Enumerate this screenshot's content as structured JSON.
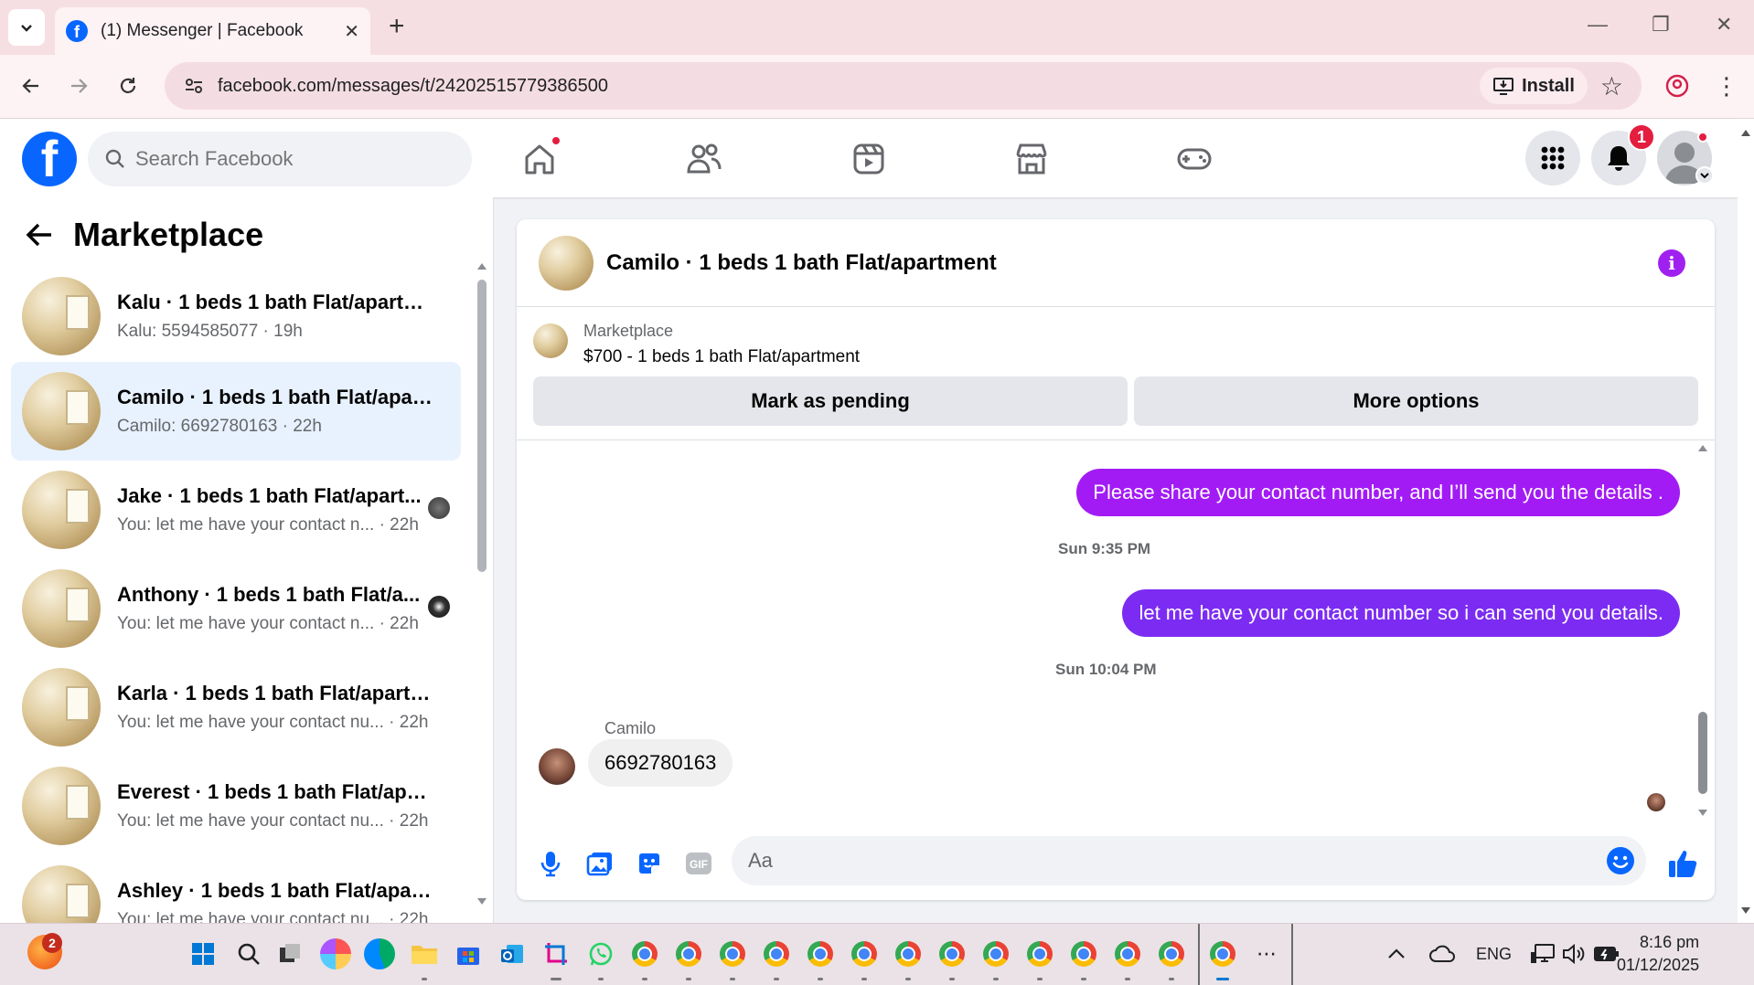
{
  "browser": {
    "tab_title": "(1) Messenger | Facebook",
    "url": "facebook.com/messages/t/24202515779386500",
    "install_label": "Install"
  },
  "fb": {
    "search_placeholder": "Search Facebook",
    "notification_count": "1"
  },
  "sidebar": {
    "title": "Marketplace",
    "conversations": [
      {
        "name": "Kalu · 1 beds 1 bath Flat/apartm...",
        "preview": "Kalu: 5594585077 · 19h"
      },
      {
        "name": "Camilo · 1 beds 1 bath Flat/apart...",
        "preview": "Camilo: 6692780163 · 22h"
      },
      {
        "name": "Jake · 1 beds 1 bath Flat/apart...",
        "preview": "You: let me have your contact n... · 22h"
      },
      {
        "name": "Anthony · 1 beds 1 bath Flat/a...",
        "preview": "You: let me have your contact n... · 22h"
      },
      {
        "name": "Karla · 1 beds 1 bath Flat/apartm...",
        "preview": "You: let me have your contact nu...  · 22h"
      },
      {
        "name": "Everest · 1 beds 1 bath Flat/apart...",
        "preview": "You: let me have your contact nu...  · 22h"
      },
      {
        "name": "Ashley · 1 beds 1 bath Flat/apart...",
        "preview": "You: let me have your contact nu...  · 22h"
      }
    ]
  },
  "chat": {
    "title": "Camilo · 1 beds 1 bath Flat/apartment",
    "listing_label": "Marketplace",
    "listing_price": "$700 - 1 beds 1 bath Flat/apartment",
    "mark_pending": "Mark as pending",
    "more_options": "More options",
    "messages": [
      {
        "text": "Please share your contact number, and I’ll send you the details .",
        "color": "#a21bf5"
      },
      {
        "timestamp": "Sun 9:35 PM"
      },
      {
        "text": "let me have your contact number so i can send you details.",
        "color": "#7c2cf2"
      },
      {
        "timestamp": "Sun 10:04 PM"
      }
    ],
    "incoming_sender": "Camilo",
    "incoming_text": "6692780163",
    "input_placeholder": "Aa"
  },
  "taskbar": {
    "notif_badge": "2",
    "lang": "ENG",
    "time": "8:16 pm",
    "date": "01/12/2025"
  },
  "colors": {
    "fb_blue": "#0866ff",
    "messenger_purple": "#a21bf5",
    "notification_red": "#e41e3f"
  }
}
